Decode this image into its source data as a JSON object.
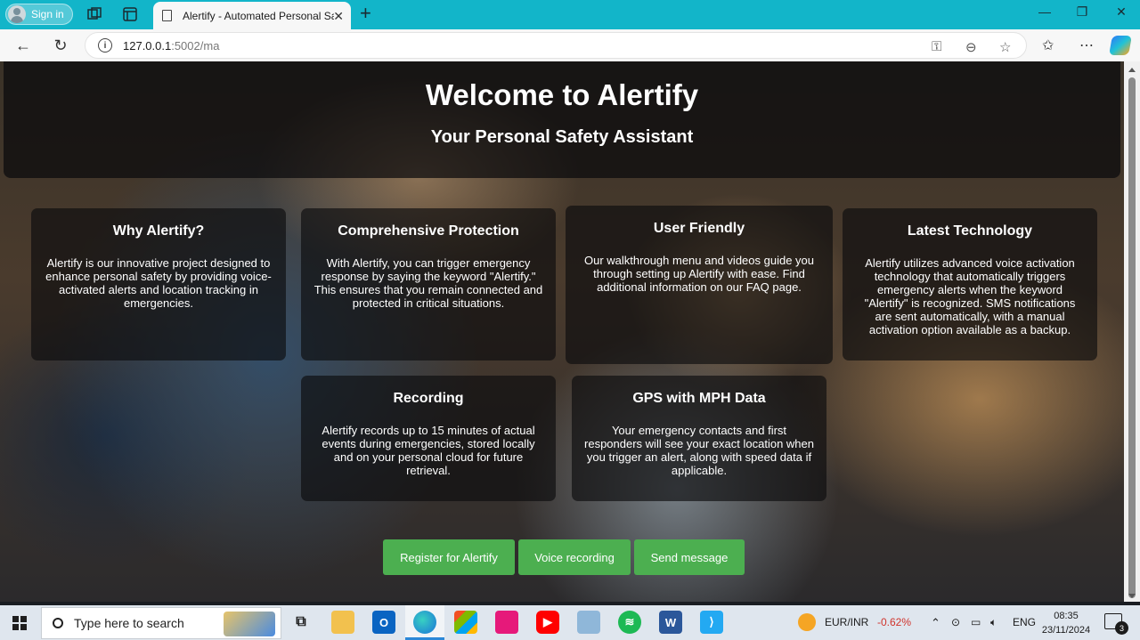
{
  "browser": {
    "signin_label": "Sign in",
    "tab_title": "Alertify - Automated Personal Saf",
    "url_host": "127.0.0.1",
    "url_path": ":5002/ma",
    "accent_color": "#12b5c9"
  },
  "page": {
    "title": "Welcome to Alertify",
    "subtitle": "Your Personal Safety Assistant",
    "cards": [
      {
        "title": "Why Alertify?",
        "text": "Alertify is our innovative project designed to enhance personal safety by providing voice-activated alerts and location tracking in emergencies."
      },
      {
        "title": "Comprehensive Protection",
        "text": "With Alertify, you can trigger emergency response by saying the keyword \"Alertify.\" This ensures that you remain connected and protected in critical situations."
      },
      {
        "title": "User Friendly",
        "text": "Our walkthrough menu and videos guide you through setting up Alertify with ease. Find additional information on our FAQ page."
      },
      {
        "title": "Latest Technology",
        "text": "Alertify utilizes advanced voice activation technology that automatically triggers emergency alerts when the keyword \"Alertify\" is recognized. SMS notifications are sent automatically, with a manual activation option available as a backup."
      },
      {
        "title": "Recording",
        "text": "Alertify records up to 15 minutes of actual events during emergencies, stored locally and on your personal cloud for future retrieval."
      },
      {
        "title": "GPS with MPH Data",
        "text": "Your emergency contacts and first responders will see your exact location when you trigger an alert, along with speed data if applicable."
      }
    ],
    "buttons": {
      "register": "Register for Alertify",
      "voice": "Voice recording",
      "message": "Send message"
    },
    "button_color": "#4caf50"
  },
  "taskbar": {
    "search_placeholder": "Type here to search",
    "currency_pair": "EUR/INR",
    "currency_change": "-0.62%",
    "language": "ENG",
    "time": "08:35",
    "date": "23/11/2024",
    "notification_count": "3",
    "apps": [
      "task-view",
      "file-explorer",
      "outlook",
      "edge",
      "microsoft-store",
      "app-pink",
      "youtube",
      "notes",
      "spotify",
      "word",
      "vscode"
    ]
  }
}
